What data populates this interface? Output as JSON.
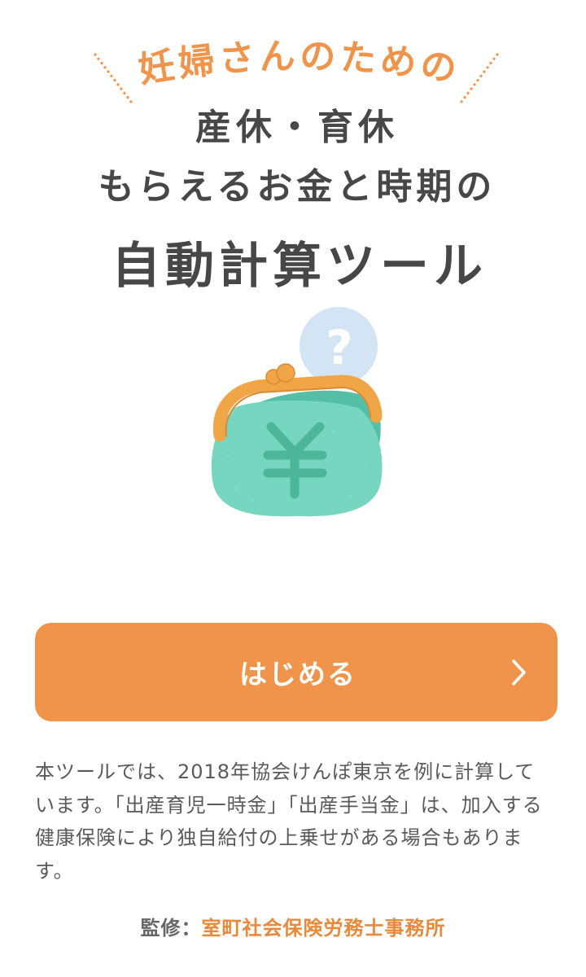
{
  "header": {
    "tagline": "妊婦さんのための",
    "title_line1": "産休・育休",
    "title_line2": "もらえるお金と時期の",
    "title_line3": "自動計算ツール"
  },
  "illustration": {
    "icon": "coin-purse-icon",
    "currency_icon": "yen-icon",
    "bubble_icon": "question-bubble-icon",
    "bubble_text": "?"
  },
  "start_button": {
    "label": "はじめる",
    "icon": "chevron-right-icon"
  },
  "notice": {
    "text": "本ツールでは、2018年協会けんぽ東京を例に計算しています。「出産育児一時金」「出産手当金」は、加入する健康保険により独自給付の上乗せがある場合もあります。"
  },
  "supervision": {
    "label": "監修：",
    "name": "室町社会保険労務士事務所"
  },
  "colors": {
    "accent": "#EF944A",
    "title_text": "#474747",
    "body_text": "#5A5A5A",
    "button_text": "#FFFFFF",
    "purse_green": "#77D6C0",
    "purse_shadow": "#55BFA6",
    "yen_green": "#4DB69A",
    "clasp_orange": "#F0A546",
    "bubble_blue": "#D3E4F5",
    "page_bg": "#FFFFFF"
  }
}
